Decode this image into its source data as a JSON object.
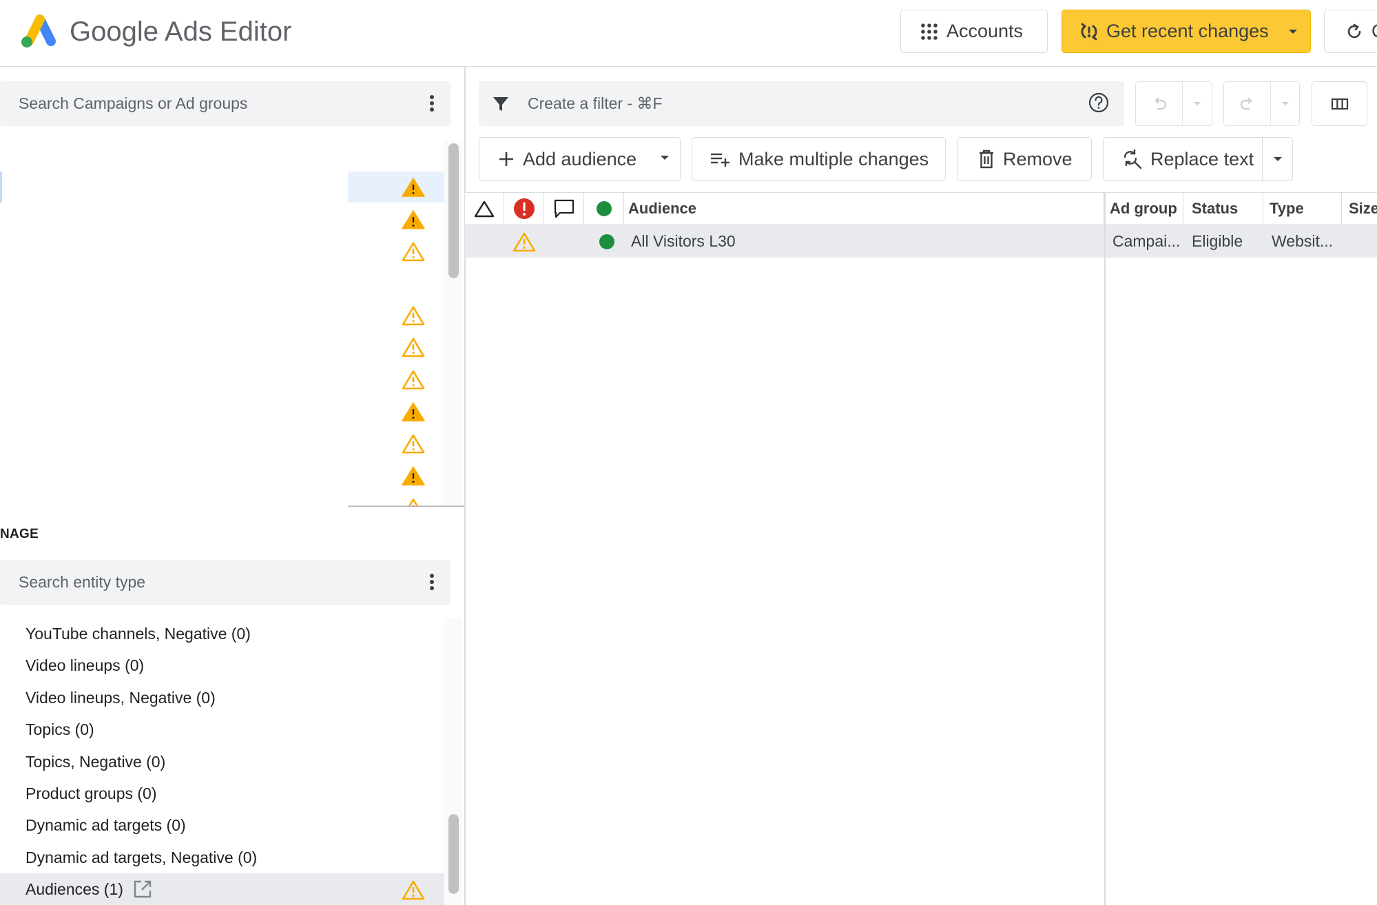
{
  "app": {
    "title": "Google Ads Editor",
    "brand_colors": {
      "blue": "#4285f4",
      "yellow": "#fbbc04",
      "green": "#34a853"
    }
  },
  "header": {
    "accounts_label": "Accounts",
    "get_recent_changes_label": "Get recent changes",
    "refresh_label_partial": "C",
    "accent_color": "#fcc934"
  },
  "tree": {
    "search_placeholder": "Search Campaigns or Ad groups",
    "warning_icon_color": "#f9ab00"
  },
  "manage": {
    "heading": "NAGE",
    "search_placeholder": "Search entity type",
    "items": [
      {
        "label": "YouTube channels, Negative (0)"
      },
      {
        "label": "Video lineups (0)"
      },
      {
        "label": "Video lineups, Negative (0)"
      },
      {
        "label": "Topics (0)"
      },
      {
        "label": "Topics, Negative (0)"
      },
      {
        "label": "Product groups (0)"
      },
      {
        "label": "Dynamic ad targets (0)"
      },
      {
        "label": "Dynamic ad targets, Negative (0)"
      },
      {
        "label": "Audiences (1)",
        "selected": true,
        "has_external_link": true,
        "has_warning": true
      }
    ]
  },
  "filter": {
    "placeholder": "Create a filter - ⌘F"
  },
  "toolbar": {
    "add_audience_label": "Add audience",
    "make_multiple_changes_label": "Make multiple changes",
    "remove_label": "Remove",
    "replace_text_label": "Replace text"
  },
  "grid": {
    "columns": {
      "audience": "Audience",
      "ad_group": "Ad group",
      "status": "Status",
      "type": "Type",
      "size": "Size"
    },
    "rows": [
      {
        "warning": true,
        "enabled": true,
        "audience": "All Visitors L30",
        "ad_group": "Campai...",
        "status": "Eligible",
        "type": "Websit..."
      }
    ],
    "status_colors": {
      "error": "#d93025",
      "enabled": "#1e8e3e"
    }
  }
}
